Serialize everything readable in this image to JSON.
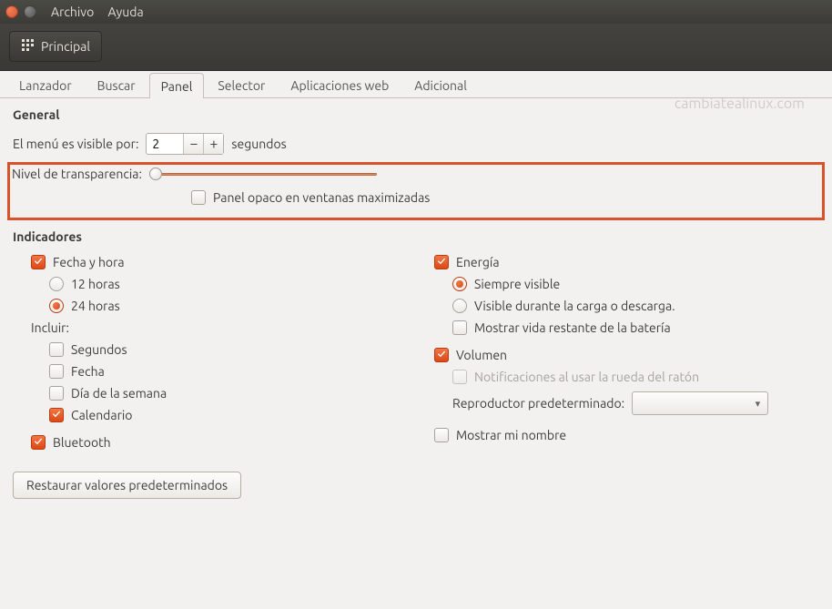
{
  "menubar": {
    "file": "Archivo",
    "help": "Ayuda"
  },
  "toolbar": {
    "main": "Principal"
  },
  "tabs": [
    "Lanzador",
    "Buscar",
    "Panel",
    "Selector",
    "Aplicaciones web",
    "Adicional"
  ],
  "active_tab_index": 2,
  "watermark": "cambiatealinux.com",
  "general": {
    "title": "General",
    "menu_visible": {
      "label": "El menú es visible por:",
      "value": "2",
      "unit": "segundos"
    },
    "transparency_label": "Nivel de transparencia:",
    "transparency_value": 0,
    "opaque_panel": {
      "label": "Panel opaco en ventanas maximizadas",
      "checked": false
    }
  },
  "indicators": {
    "title": "Indicadores",
    "datetime": {
      "label": "Fecha y hora",
      "checked": true,
      "hours12": {
        "label": "12 horas",
        "checked": false
      },
      "hours24": {
        "label": "24 horas",
        "checked": true
      },
      "include_label": "Incluir:",
      "seconds": {
        "label": "Segundos",
        "checked": false
      },
      "date": {
        "label": "Fecha",
        "checked": false
      },
      "weekday": {
        "label": "Día de la semana",
        "checked": false
      },
      "calendar": {
        "label": "Calendario",
        "checked": true
      }
    },
    "bluetooth": {
      "label": "Bluetooth",
      "checked": true
    },
    "energy": {
      "label": "Energía",
      "checked": true,
      "always": {
        "label": "Siempre visible",
        "checked": true
      },
      "charging": {
        "label": "Visible durante la carga o descarga.",
        "checked": false
      },
      "remaining": {
        "label": "Mostrar vida restante de la batería",
        "checked": false
      }
    },
    "volume": {
      "label": "Volumen",
      "checked": true,
      "wheel_notify": {
        "label": "Notificaciones al usar la rueda del ratón",
        "checked": false,
        "disabled": true
      },
      "default_player_label": "Reproductor predeterminado:",
      "default_player_value": ""
    },
    "show_name": {
      "label": "Mostrar mi nombre",
      "checked": false
    }
  },
  "restore_defaults": "Restaurar valores predeterminados"
}
